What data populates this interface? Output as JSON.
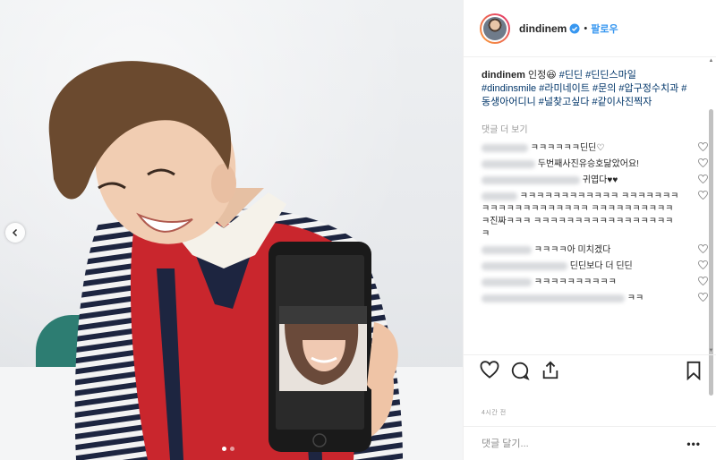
{
  "post": {
    "username": "dindinem",
    "follow_label": "팔로우",
    "separator": "•",
    "caption_user": "dindinem",
    "caption_text": "인정😆",
    "caption_tags": "#딘딘 #딘딘스마일 #dindinsmile #라미네이트 #문의 #압구정수치과 #동생아어디니 #널찾고싶다 #같이사진찍자",
    "more_comments": "댓글 더 보기",
    "time": "4시간 전",
    "add_comment_placeholder": "댓글 달기...",
    "more_options": "•••"
  },
  "comments": [
    {
      "prefix": "",
      "text": "ㅋㅋㅋㅋㅋㅋ딘딘♡"
    },
    {
      "prefix": "",
      "text": "두번째사진유승호닮았어요!"
    },
    {
      "prefix": "",
      "text": "귀엽다♥♥"
    },
    {
      "prefix": "",
      "text": "ㅋㅋㅋㅋㅋㅋㅋㅋㅋㅋㅋㅋ ㅋㅋㅋㅋㅋㅋㅋㅋㅋㅋㅋㅋㅋㅋㅋㅋㅋㅋㅋㅋ ㅋㅋㅋㅋㅋㅋㅋㅋㅋㅋㅋ진짜ㅋㅋㅋ ㅋㅋㅋㅋㅋㅋㅋㅋㅋㅋㅋㅋㅋㅋㅋㅋㅋㅋ"
    },
    {
      "prefix": "",
      "text": "ㅋㅋㅋㅋ아 미치겠다"
    },
    {
      "prefix": "",
      "text": "딘딘보다 더 딘딘"
    },
    {
      "prefix": "",
      "text": "ㅋㅋㅋㅋㅋㅋㅋㅋㅋㅋ"
    },
    {
      "prefix": "",
      "text": "ㅋㅋ"
    }
  ],
  "colors": {
    "link": "#3897f0",
    "tag": "#003569",
    "text": "#262626",
    "muted": "#999999"
  },
  "icons": [
    "heart-icon",
    "comment-icon",
    "share-icon",
    "bookmark-icon",
    "verified-icon",
    "chevron-left-icon"
  ]
}
